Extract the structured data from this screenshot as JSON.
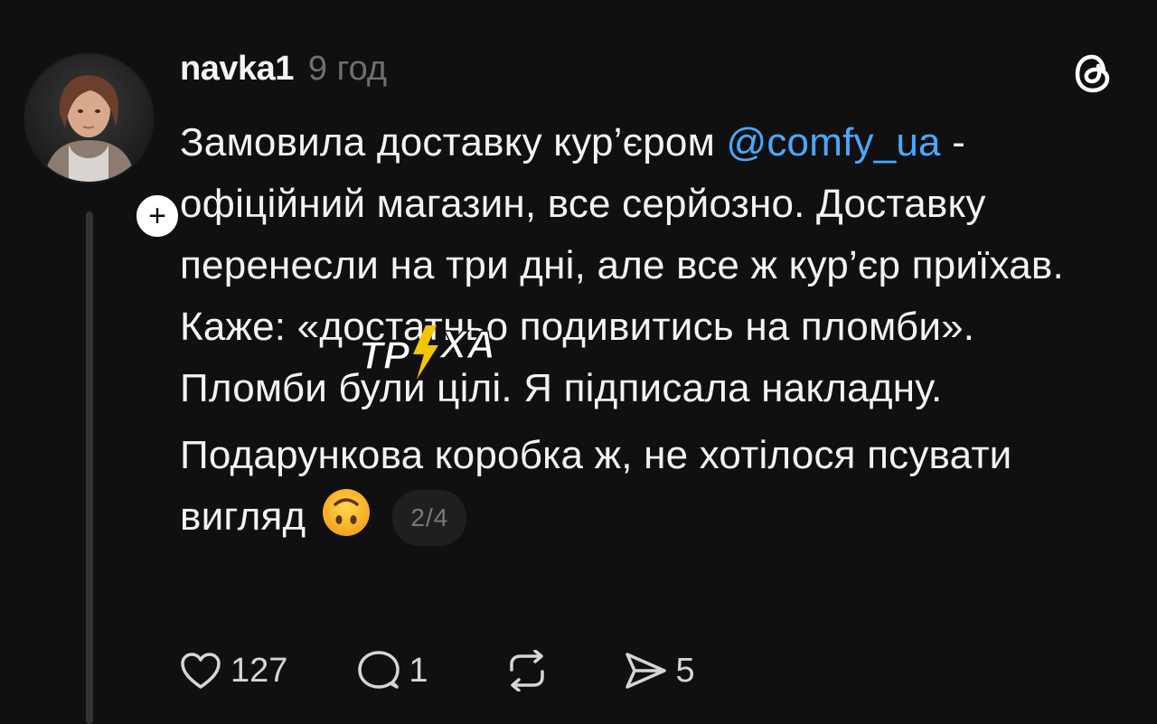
{
  "post": {
    "username": "navka1",
    "timestamp": "9 год",
    "paragraph1": {
      "before_mention": "Замовила доставку кур’єром ",
      "mention": "@comfy_ua",
      "after_mention": " - офіційний магазин, все серйозно. Доставку перенесли на три дні, але все ж кур’єр приїхав. Каже: «достатньо подивитись на пломби». Пломби були цілі. Я підписала накладну."
    },
    "paragraph2": "Подарункова коробка ж, не хотілося псувати вигляд",
    "emoji_name": "upside-down-face",
    "page_counter": "2/4"
  },
  "actions": {
    "likes": "127",
    "replies": "1",
    "shares": "5"
  },
  "watermark": {
    "left": "ТР",
    "right": "ХА"
  },
  "icons": {
    "threads_logo": "threads-logo-icon",
    "follow": "plus-icon",
    "like": "heart-icon",
    "reply": "comment-icon",
    "repost": "repost-icon",
    "share": "send-icon"
  },
  "colors": {
    "background": "#101010",
    "mention": "#4aa8ff",
    "text": "#f3f3f3",
    "muted": "#6f6f6f",
    "watermark_bolt": "#f5c400"
  }
}
